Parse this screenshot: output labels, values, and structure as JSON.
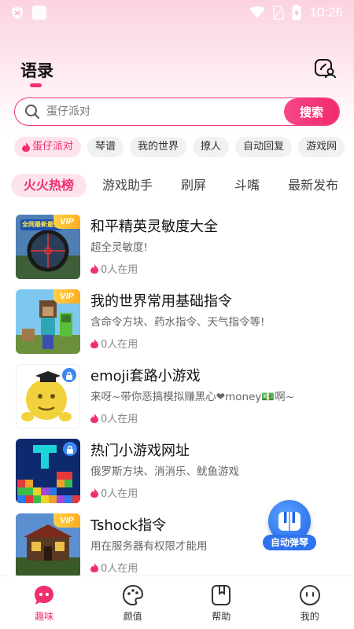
{
  "status_bar": {
    "time": "10:26"
  },
  "header": {
    "title": "语录"
  },
  "search": {
    "placeholder": "蛋仔派对",
    "button_label": "搜索"
  },
  "chips": [
    {
      "label": "蛋仔派对",
      "active": true
    },
    {
      "label": "琴谱"
    },
    {
      "label": "我的世界"
    },
    {
      "label": "撩人"
    },
    {
      "label": "自动回复"
    },
    {
      "label": "游戏网"
    }
  ],
  "tabs": [
    {
      "label": "火火热榜",
      "active": true
    },
    {
      "label": "游戏助手"
    },
    {
      "label": "刷屏"
    },
    {
      "label": "斗嘴"
    },
    {
      "label": "最新发布"
    }
  ],
  "items": [
    {
      "title": "和平精英灵敏度大全",
      "desc": "超全灵敏度!",
      "usage": "0人在用",
      "badge": "VIP"
    },
    {
      "title": "我的世界常用基础指令",
      "desc": "含命令方块、药水指令、天气指令等!",
      "usage": "0人在用",
      "badge": "VIP"
    },
    {
      "title": "emoji套路小游戏",
      "desc": "来呀~带你恶搞模拟赚黑心❤money💵啊~",
      "usage": "0人在用",
      "badge": "lock"
    },
    {
      "title": "热门小游戏网址",
      "desc": "俄罗斯方块、消消乐、鱿鱼游戏",
      "usage": "0人在用",
      "badge": "lock"
    },
    {
      "title": "Tshock指令",
      "desc": "用在服务器有权限才能用",
      "usage": "0人在用",
      "badge": "VIP"
    }
  ],
  "thumb_text": {
    "item0": "全网最新最全"
  },
  "float_button": {
    "label": "自动弹琴"
  },
  "bottom_nav": [
    {
      "label": "趣味",
      "active": true,
      "icon": "chat-bubble-icon"
    },
    {
      "label": "颜值",
      "icon": "palette-icon"
    },
    {
      "label": "帮助",
      "icon": "bookmark-icon"
    },
    {
      "label": "我的",
      "icon": "smiley-icon"
    }
  ],
  "colors": {
    "accent": "#f0306c",
    "vip": "#ffb020",
    "lock": "#3d86f5"
  }
}
